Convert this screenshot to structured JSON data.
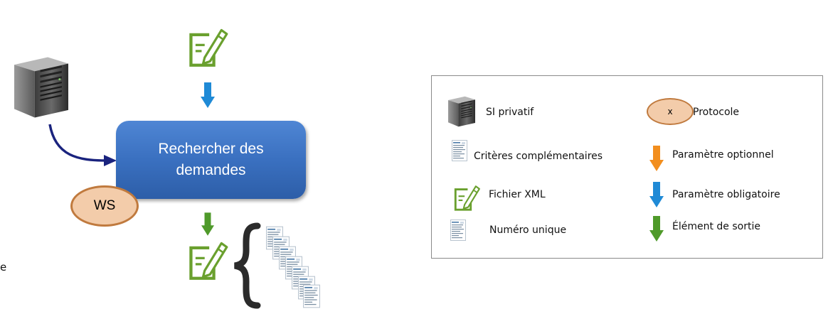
{
  "process": {
    "line1": "Rechercher des",
    "line2": "demandes"
  },
  "protocol_badge": "WS",
  "legend": {
    "si_privatif": "SI privatif",
    "protocole_symbol": "x",
    "protocole": "Protocole",
    "criteres": "Critères complémentaires",
    "param_optionnel": "Paramètre optionnel",
    "fichier_xml": "Fichier XML",
    "param_obligatoire": "Paramètre obligatoire",
    "numero_unique": "Numéro unique",
    "element_sortie": "Élément de sortie"
  },
  "stray_char": "e",
  "colors": {
    "process_fill": "#3a70c0",
    "protocol_fill": "#f3ccaa",
    "protocol_border": "#c07a3e",
    "optional_arrow": "#f28e1e",
    "mandatory_arrow": "#1f8ad6",
    "output_arrow": "#4f9a2a",
    "xml_icon": "#6aa02e",
    "connector": "#1a237e"
  },
  "icons": [
    "server-icon",
    "xml-file-icon",
    "document-icon",
    "curly-brace-icon"
  ]
}
